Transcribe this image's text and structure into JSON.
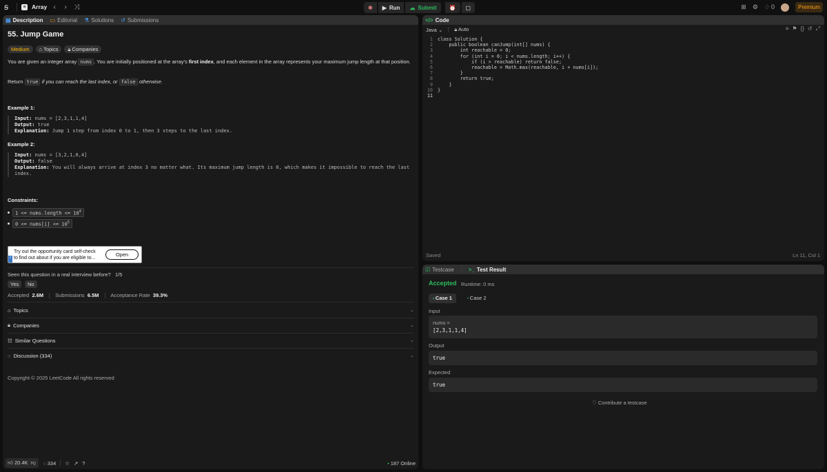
{
  "topbar": {
    "title": "Array",
    "run_label": "Run",
    "submit_label": "Submit",
    "notif_count": "0",
    "premium_label": "Premium"
  },
  "tabs": [
    "Description",
    "Editorial",
    "Solutions",
    "Submissions"
  ],
  "problem": {
    "title": "55. Jump Game",
    "difficulty": "Medium",
    "topics_label": "Topics",
    "companies_label": "Companies",
    "p1a": "You are given an integer array ",
    "p1code": "nums",
    "p1b": ". You are initially positioned at the array's ",
    "p1bold": "first index",
    "p1c": ", and each element in the array represents your maximum jump length at that position.",
    "p2a": "Return ",
    "p2true": "true",
    "p2b": " if you can reach the last index, or ",
    "p2false": "false",
    "p2c": " otherwise."
  },
  "examples": [
    {
      "heading": "Example 1:",
      "input_label": "Input:",
      "input": " nums = [2,3,1,1,4]",
      "output_label": "Output:",
      "output": " true",
      "expl_label": "Explanation:",
      "expl": " Jump 1 step from index 0 to 1, then 3 steps to the last index."
    },
    {
      "heading": "Example 2:",
      "input_label": "Input:",
      "input": " nums = [3,2,1,0,4]",
      "output_label": "Output:",
      "output": " false",
      "expl_label": "Explanation:",
      "expl": " You will always arrive at index 3 no matter what. Its maximum jump length is 0, which makes it impossible to reach the last index."
    }
  ],
  "constraints": {
    "heading": "Constraints:",
    "c1": "1 <= nums.length <= 10",
    "c1exp": "4",
    "c2": "0 <= nums[i] <= 10",
    "c2exp": "5"
  },
  "promo": {
    "line1": "Try out the opportunity card self-check",
    "line2": "to find out about if you are eligible to...",
    "button": "Open"
  },
  "interview": {
    "question": "Seen this question in a real interview before?",
    "ratio": "1/5",
    "yes": "Yes",
    "no": "No"
  },
  "stats": {
    "accepted_label": "Accepted",
    "accepted": "2.6M",
    "submissions_label": "Submissions",
    "submissions": "6.5M",
    "rate_label": "Acceptance Rate",
    "rate": "39.3%"
  },
  "sections": [
    "Topics",
    "Companies",
    "Similar Questions",
    "Discussion (334)"
  ],
  "copyright": "Copyright © 2025 LeetCode All rights reserved",
  "footer": {
    "likes": "20.4K",
    "comments": "334",
    "online": "187 Online"
  },
  "code": {
    "tab_label": "Code",
    "language": "Java",
    "mode": "Auto",
    "lines": [
      "class Solution {",
      "    public boolean canJump(int[] nums) {",
      "        int reachable = 0;",
      "        for (int i = 0; i < nums.length; i++) {",
      "            if (i > reachable) return false;",
      "            reachable = Math.max(reachable, i + nums[i]);",
      "        }",
      "        return true;",
      "    }",
      "}",
      ""
    ],
    "status": "Saved",
    "cursor": "Ln 11, Col 1"
  },
  "test": {
    "tab1": "Testcase",
    "tab2": "Test Result",
    "result": "Accepted",
    "runtime": "Runtime: 0 ms",
    "case1": "Case 1",
    "case2": "Case 2",
    "input_label": "Input",
    "input_name": "nums =",
    "input_value": "[2,3,1,1,4]",
    "output_label": "Output",
    "output_value": "true",
    "expected_label": "Expected",
    "expected_value": "true",
    "contribute": "Contribute a testcase"
  },
  "colors": {
    "accent": "#ffa116",
    "success": "#2cbb5d",
    "panel": "#1a1a1a",
    "bg": "#0f0f0f"
  }
}
